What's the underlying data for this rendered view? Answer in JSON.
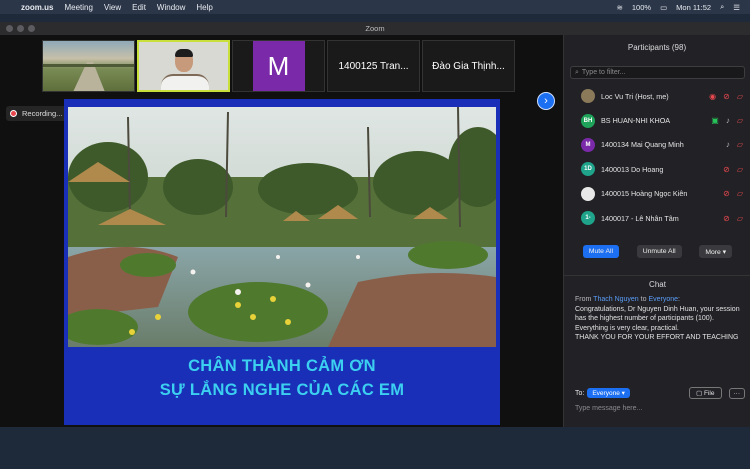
{
  "menubar": {
    "app_name": "zoom.us",
    "menus": [
      "Meeting",
      "View",
      "Edit",
      "Window",
      "Help"
    ],
    "battery": "100%",
    "clock": "Mon 11:52"
  },
  "window": {
    "title": "Zoom"
  },
  "thumbnails": [
    {
      "kind": "video-field",
      "label": ""
    },
    {
      "kind": "video-person",
      "label": ""
    },
    {
      "kind": "avatar",
      "label": "M",
      "color": "#7a2aa8"
    },
    {
      "kind": "name",
      "label": "1400125 Tran..."
    },
    {
      "kind": "name",
      "label": "Đào Gia Thịnh..."
    }
  ],
  "recording": {
    "label": "Recording..."
  },
  "slide": {
    "line1": "CHÂN THÀNH CẢM ƠN",
    "line2": "SỰ LẮNG NGHE CỦA CÁC EM"
  },
  "participants": {
    "title": "Participants (98)",
    "filter_placeholder": "Type to filter...",
    "list": [
      {
        "initials": "",
        "name": "Loc Vu Tri (Host, me)",
        "color": "#8a7a5a",
        "photo": true
      },
      {
        "initials": "BH",
        "name": "BS HUAN-NHI KHOA",
        "color": "#1fa35a"
      },
      {
        "initials": "M",
        "name": "1400134 Mai Quang Minh",
        "color": "#7a2aa8"
      },
      {
        "initials": "1D",
        "name": "1400013 Do Hoang",
        "color": "#1fa38a"
      },
      {
        "initials": "",
        "name": "1400015 Hoàng Ngọc Kiên",
        "color": "#e8e8e8",
        "photo": true
      },
      {
        "initials": "1-",
        "name": "1400017 - Lê Nhân Tâm",
        "color": "#1fa38a"
      }
    ],
    "mute_all": "Mute All",
    "unmute_all": "Unmute All",
    "more": "More ▾"
  },
  "chat": {
    "title": "Chat",
    "from_prefix": "From",
    "from_name": "Thach Nguyen",
    "to_word": "to",
    "to_name": "Everyone",
    "message": "Congratulations, Dr Nguyen Dinh Huan, your session has the highest number of participants (100).",
    "message2": "Everything is very clear, practical.",
    "message3": "THANK YOU FOR YOUR EFFORT AND TEACHING",
    "to_label": "To:",
    "to_select": "Everyone ▾",
    "file_button": "File",
    "more_button": "···",
    "input_placeholder": "Type message here..."
  }
}
